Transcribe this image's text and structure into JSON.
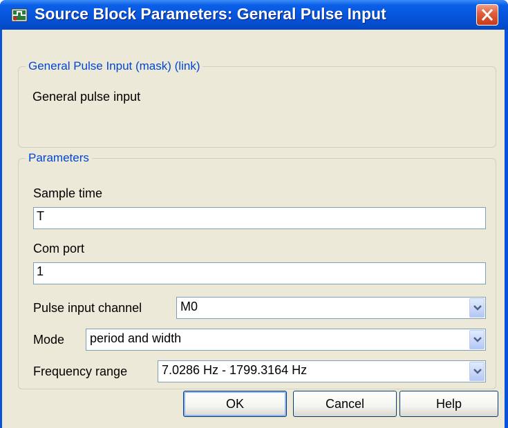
{
  "window": {
    "title": "Source Block Parameters: General Pulse Input"
  },
  "description_group": {
    "legend": "General Pulse Input (mask) (link)",
    "text": "General pulse input"
  },
  "parameters_group": {
    "legend": "Parameters",
    "sample_time": {
      "label": "Sample time",
      "value": "T"
    },
    "com_port": {
      "label": "Com port",
      "value": "1"
    },
    "pulse_input_channel": {
      "label": "Pulse input channel",
      "value": "M0"
    },
    "mode": {
      "label": "Mode",
      "value": "period and width"
    },
    "frequency_range": {
      "label": "Frequency range",
      "value": "7.0286 Hz - 1799.3164 Hz"
    }
  },
  "buttons": {
    "ok": "OK",
    "cancel": "Cancel",
    "help": "Help"
  },
  "colors": {
    "title_bar": "#0653d8",
    "legend_text": "#0046d5",
    "dialog_bg": "#ece9d8",
    "close_button": "#e06040"
  },
  "icons": {
    "title": "simulink-block-icon",
    "close": "close-icon",
    "dropdown": "chevron-down-icon"
  }
}
